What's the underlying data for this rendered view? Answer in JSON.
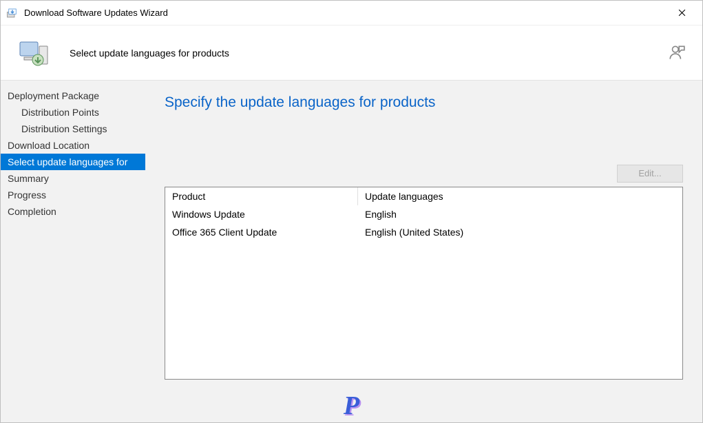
{
  "window": {
    "title": "Download Software Updates Wizard"
  },
  "header": {
    "subtitle": "Select update languages for products"
  },
  "sidebar": {
    "steps": [
      {
        "label": "Deployment Package",
        "sub": false,
        "active": false
      },
      {
        "label": "Distribution Points",
        "sub": true,
        "active": false
      },
      {
        "label": "Distribution Settings",
        "sub": true,
        "active": false
      },
      {
        "label": "Download Location",
        "sub": false,
        "active": false
      },
      {
        "label": "Select update languages for",
        "sub": false,
        "active": true
      },
      {
        "label": "Summary",
        "sub": false,
        "active": false
      },
      {
        "label": "Progress",
        "sub": false,
        "active": false
      },
      {
        "label": "Completion",
        "sub": false,
        "active": false
      }
    ]
  },
  "page": {
    "title": "Specify the update languages for products",
    "edit_label": "Edit..."
  },
  "grid": {
    "columns": {
      "product": "Product",
      "languages": "Update languages"
    },
    "rows": [
      {
        "product": "Windows Update",
        "languages": "English"
      },
      {
        "product": "Office 365 Client Update",
        "languages": "English (United States)"
      }
    ]
  },
  "watermark": "P"
}
